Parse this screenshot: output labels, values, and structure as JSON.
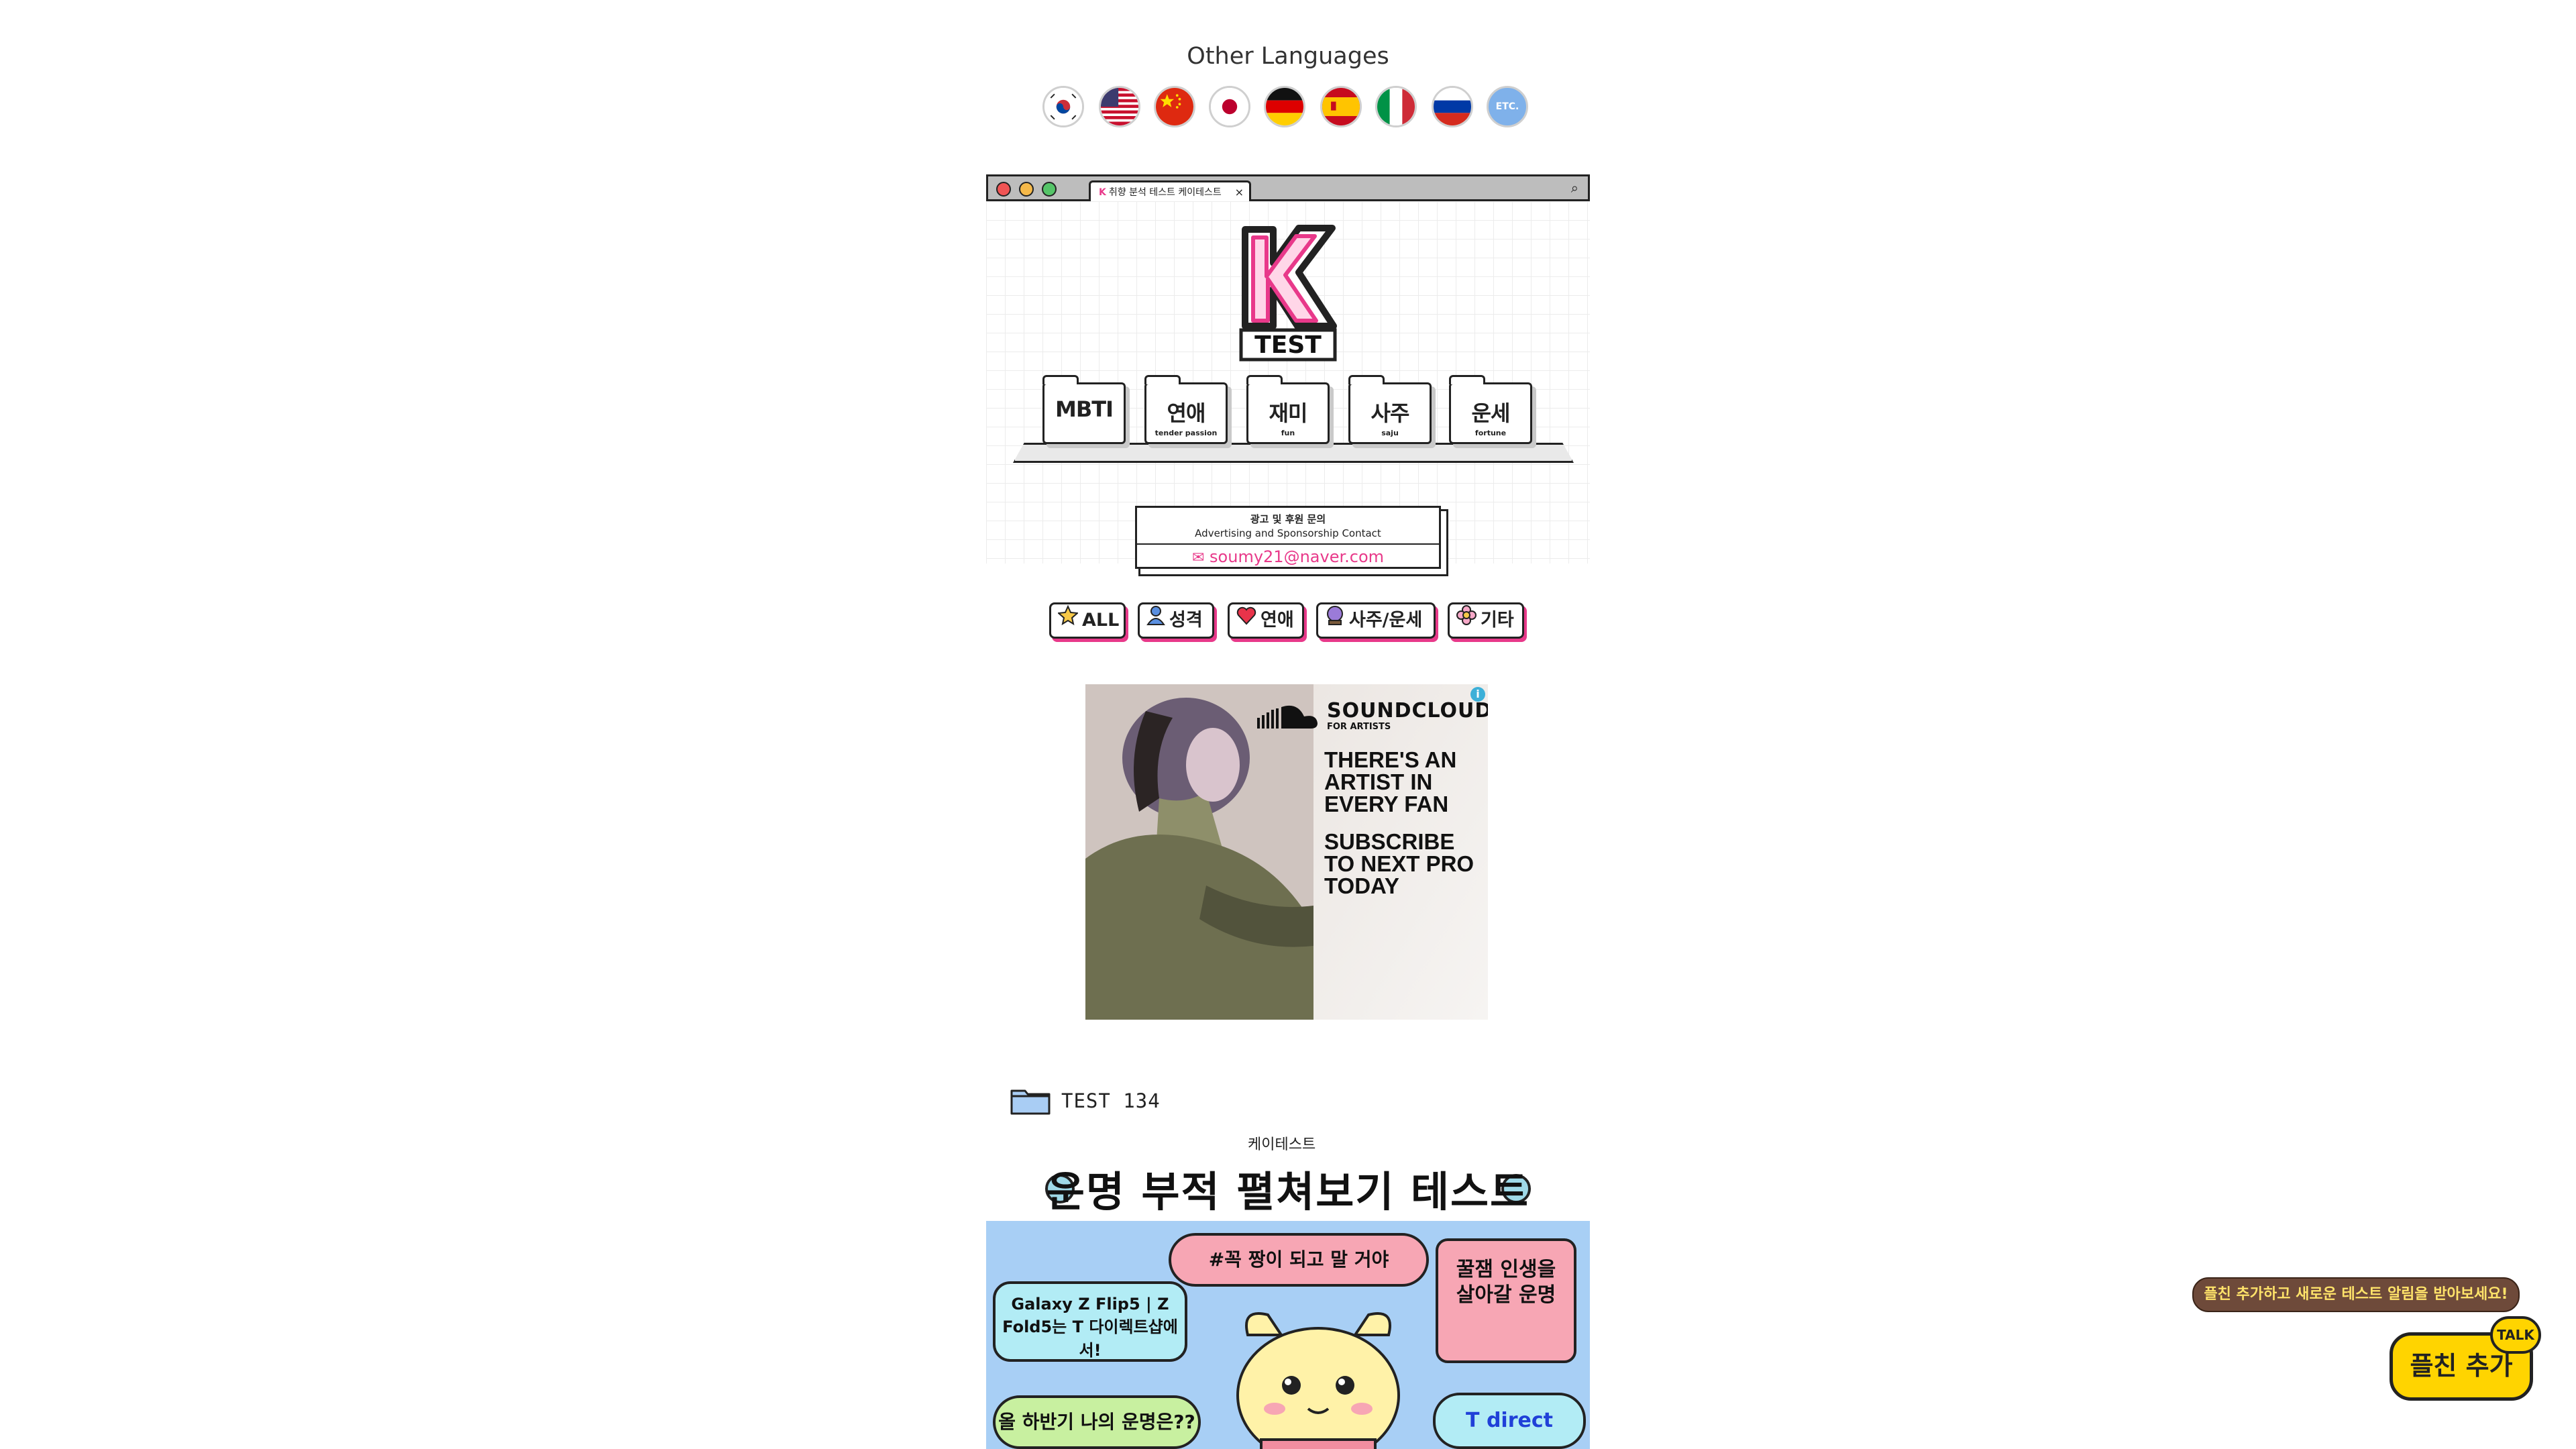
{
  "languages": {
    "title": "Other Languages",
    "flags": [
      "korea-flag-icon",
      "usa-flag-icon",
      "china-flag-icon",
      "japan-flag-icon",
      "germany-flag-icon",
      "spain-flag-icon",
      "italy-flag-icon",
      "russia-flag-icon",
      "etc-flag-icon"
    ],
    "etc_label": "ETC."
  },
  "browser": {
    "tab_title": "취향 분석 테스트 케이테스트",
    "tab_close": "×",
    "logo_text": "TEST",
    "folders": [
      {
        "label": "MBTI",
        "sub": ""
      },
      {
        "label": "연애",
        "sub": "tender passion"
      },
      {
        "label": "재미",
        "sub": "fun"
      },
      {
        "label": "사주",
        "sub": "saju"
      },
      {
        "label": "운세",
        "sub": "fortune"
      }
    ],
    "contact": {
      "title_ko": "광고 및 후원 문의",
      "title_en": "Advertising and Sponsorship Contact",
      "email": "soumy21@naver.com"
    }
  },
  "categories": [
    "ALL",
    "성격",
    "연애",
    "사주/운세",
    "기타"
  ],
  "ad": {
    "brand": "SOUNDCLOUD",
    "brand_sub": "FOR ARTISTS",
    "line1": "THERE'S AN ARTIST IN EVERY FAN",
    "line2": "SUBSCRIBE TO NEXT PRO TODAY",
    "info": "i"
  },
  "test": {
    "label": "TEST 134",
    "thumb_sub": "케이테스트",
    "thumb_title": "운명 부적 펼쳐보기 테스트",
    "bubble_top": "#꼭 짱이 되고 말 거야",
    "bubble_left": "Galaxy Z Flip5 | Z Fold5는 T 다이렉트샵에서!",
    "bubble_right": "꿀잼 인생을 살아갈 운명",
    "bubble_bottom_left": "올 하반기 나의 운명은??",
    "bubble_bottom_right": "T direct shop"
  },
  "kakao": {
    "tip": "플친 추가하고 새로운 테스트 알림을 받아보세요!",
    "button": "플친 추가",
    "talk": "TALK"
  }
}
